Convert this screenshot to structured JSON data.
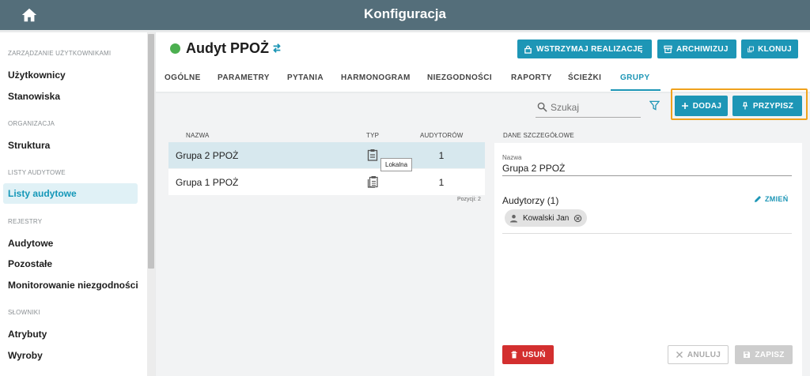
{
  "topbar": {
    "title": "Konfiguracja"
  },
  "sidebar": {
    "sections": [
      {
        "heading": "ZARZĄDZANIE UŻYTKOWNIKAMI",
        "items": [
          "Użytkownicy",
          "Stanowiska"
        ]
      },
      {
        "heading": "ORGANIZACJA",
        "items": [
          "Struktura"
        ]
      },
      {
        "heading": "LISTY AUDYTOWE",
        "items": [
          "Listy audytowe"
        ]
      },
      {
        "heading": "REJESTRY",
        "items": [
          "Audytowe",
          "Pozostałe",
          "Monitorowanie niezgodności"
        ]
      },
      {
        "heading": "SŁOWNIKI",
        "items": [
          "Atrybuty",
          "Wyroby"
        ]
      }
    ],
    "active_item": "Listy audytowe"
  },
  "header": {
    "title": "Audyt PPOŻ",
    "status_color": "#4caf50",
    "buttons": {
      "suspend": "WSTRZYMAJ REALIZACJĘ",
      "archive": "ARCHIWIZUJ",
      "clone": "KLONUJ"
    }
  },
  "tabs": [
    "OGÓLNE",
    "PARAMETRY",
    "PYTANIA",
    "HARMONOGRAM",
    "NIEZGODNOŚCI",
    "RAPORTY",
    "ŚCIEŻKI",
    "GRUPY"
  ],
  "active_tab": "GRUPY",
  "toolbar": {
    "search_placeholder": "Szukaj",
    "add_label": "DODAJ",
    "assign_label": "PRZYPISZ"
  },
  "table": {
    "columns": {
      "name": "NAZWA",
      "type": "TYP",
      "auditors": "AUDYTORÓW"
    },
    "rows": [
      {
        "name": "Grupa 2 PPOŻ",
        "auditors": "1",
        "selected": true
      },
      {
        "name": "Grupa 1 PPOŻ",
        "auditors": "1",
        "selected": false
      }
    ],
    "tooltip": "Lokalna",
    "count_label": "Pozycji: 2"
  },
  "details": {
    "heading": "DANE SZCZEGÓŁOWE",
    "name_label": "Nazwa",
    "name_value": "Grupa 2 PPOŻ",
    "auditors_label": "Audytorzy (1)",
    "change_label": "ZMIEŃ",
    "auditors": [
      "Kowalski Jan"
    ],
    "buttons": {
      "delete": "USUŃ",
      "cancel": "ANULUJ",
      "save": "ZAPISZ"
    }
  },
  "colors": {
    "accent": "#1d96b6",
    "topbar": "#546e7a",
    "danger": "#d32f2f",
    "highlight": "#f0a21c"
  }
}
